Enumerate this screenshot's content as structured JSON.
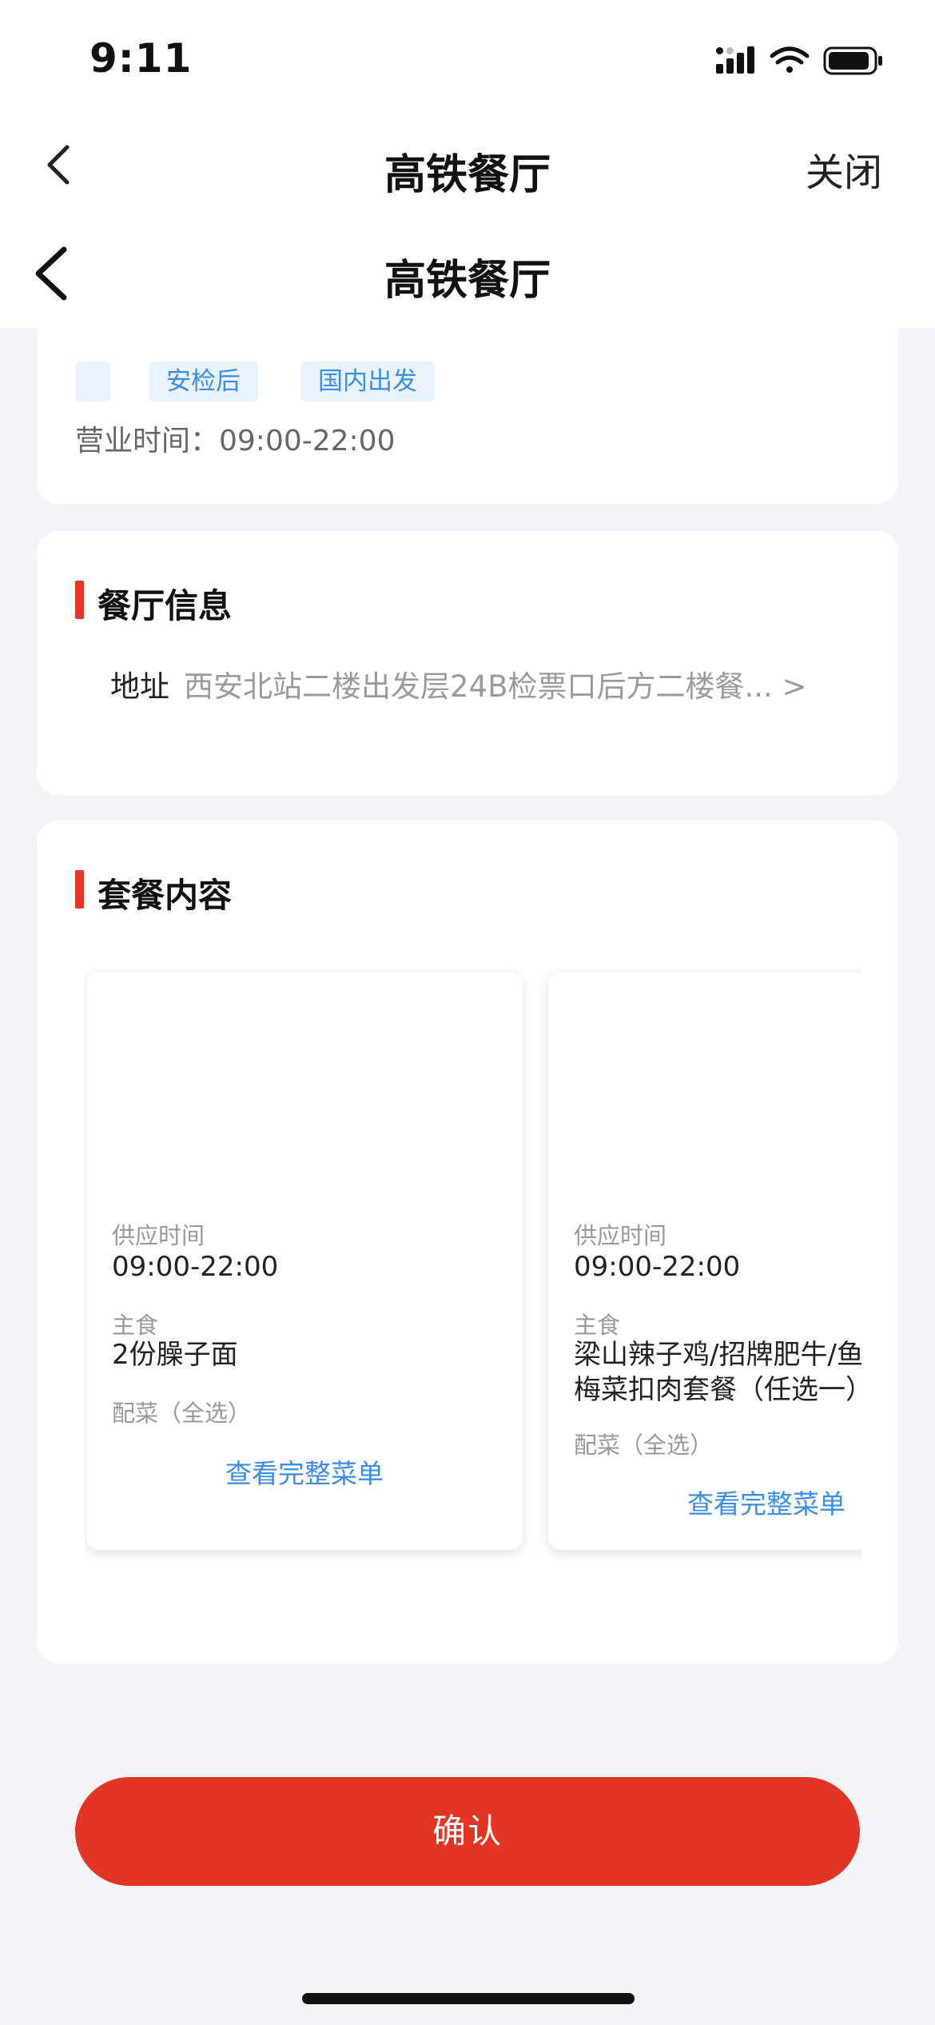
{
  "status_bar": {
    "time": "9:11"
  },
  "nav": {
    "title_outer": "高铁餐厅",
    "close": "关闭",
    "title_inner": "高铁餐厅"
  },
  "summary": {
    "tags": [
      "安检后",
      "国内出发"
    ],
    "hours": "营业时间：09:00-22:00"
  },
  "restaurant_info": {
    "section_title": "餐厅信息",
    "address_label": "地址",
    "address_value": "西安北站二楼出发层24B检票口后方二楼餐...",
    "chevron": ">"
  },
  "package": {
    "section_title": "套餐内容",
    "cards": [
      {
        "supply_label": "供应时间",
        "supply_time": "09:00-22:00",
        "main_label": "主食",
        "main_lines": [
          "2份臊子面"
        ],
        "side_label": "配菜（全选）",
        "menu_link": "查看完整菜单"
      },
      {
        "supply_label": "供应时间",
        "supply_time": "09:00-22:00",
        "main_label": "主食",
        "main_lines": [
          "梁山辣子鸡/招牌肥牛/鱼香",
          "梅菜扣肉套餐（任选一）"
        ],
        "side_label": "配菜（全选）",
        "menu_link": "查看完整菜单"
      }
    ]
  },
  "confirm_button": "确认",
  "colors": {
    "accent_red": "#e33526",
    "link_blue": "#3b8ee8",
    "tag_bg": "#e9f3fd"
  }
}
